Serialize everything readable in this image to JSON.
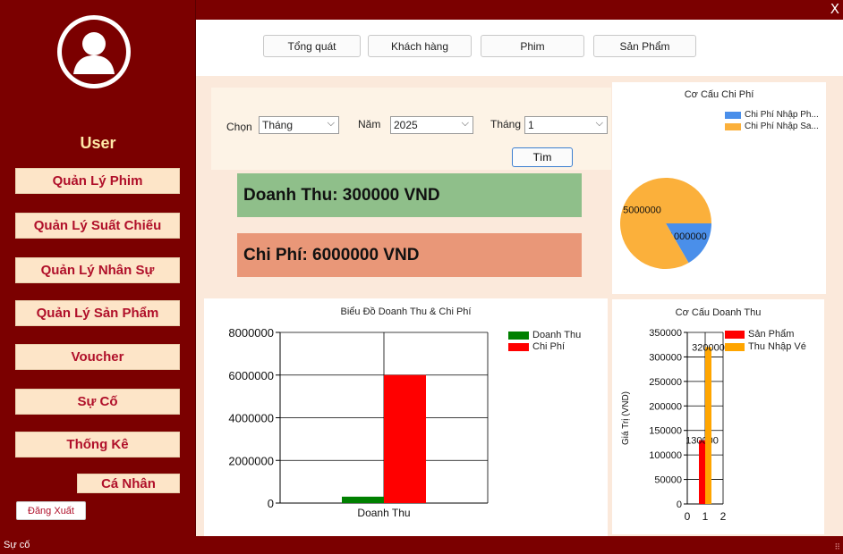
{
  "window": {
    "close_label": "X"
  },
  "sidebar": {
    "username": "User",
    "nav": [
      "Quản Lý Phim",
      "Quản Lý Suất Chiếu",
      "Quản Lý Nhân Sự",
      "Quản Lý Sản Phẩm",
      "Voucher",
      "Sự Cố",
      "Thống Kê",
      "Cá Nhân"
    ],
    "logout": "Đăng Xuất"
  },
  "tabs": [
    "Tổng quát",
    "Khách hàng",
    "Phim",
    "Sản Phẩm"
  ],
  "filter": {
    "chon_label": "Chọn",
    "chon_value": "Tháng",
    "nam_label": "Năm",
    "nam_value": "2025",
    "thang_label": "Tháng",
    "thang_value": "1",
    "find_label": "Tìm"
  },
  "cards": {
    "revenue": "Doanh Thu: 300000 VND",
    "cost": "Chi Phí: 6000000 VND"
  },
  "status": {
    "text": "Sự cố"
  },
  "colors": {
    "bg": "#7b0000",
    "nav_button": "#fde5c8",
    "nav_text": "#b0102a",
    "revenue_card": "#8fbf8a",
    "cost_card": "#e99778"
  },
  "chart_data": [
    {
      "type": "pie",
      "title": "Cơ Cấu Chi Phí",
      "labels": [
        "Chi Phí Nhập Ph...",
        "Chi Phí Nhập Sa..."
      ],
      "values": [
        1000000,
        5000000
      ],
      "data_labels": [
        "1000000",
        "5000000"
      ],
      "colors": [
        "#4a8fea",
        "#fbb03b"
      ],
      "legend": "top-right"
    },
    {
      "type": "bar",
      "title": "Biểu Đồ Doanh Thu & Chi Phí",
      "categories": [
        "Doanh Thu"
      ],
      "series": [
        {
          "name": "Doanh Thu",
          "values": [
            300000
          ],
          "color": "#008000"
        },
        {
          "name": "Chi Phí",
          "values": [
            6000000
          ],
          "color": "#ff0000"
        }
      ],
      "ylim": [
        0,
        8000000
      ],
      "yticks": [
        "0",
        "2000000",
        "4000000",
        "6000000",
        "8000000"
      ],
      "grid": true,
      "legend": "top-right"
    },
    {
      "type": "bar",
      "title": "Cơ Cấu Doanh Thu",
      "ylabel": "Giá Trị (VND)",
      "x": [
        1
      ],
      "series": [
        {
          "name": "Sản Phẩm",
          "values": [
            130000
          ],
          "color": "#ff0000"
        },
        {
          "name": "Thu Nhập Vé",
          "values": [
            320000
          ],
          "color": "#ffa500"
        }
      ],
      "data_labels": [
        "130000",
        "320000"
      ],
      "xlim": [
        0,
        2
      ],
      "xticks": [
        "0",
        "1",
        "2"
      ],
      "ylim": [
        0,
        350000
      ],
      "yticks": [
        "0",
        "50000",
        "100000",
        "150000",
        "200000",
        "250000",
        "300000",
        "350000"
      ],
      "grid": true,
      "legend": "top-right"
    }
  ]
}
